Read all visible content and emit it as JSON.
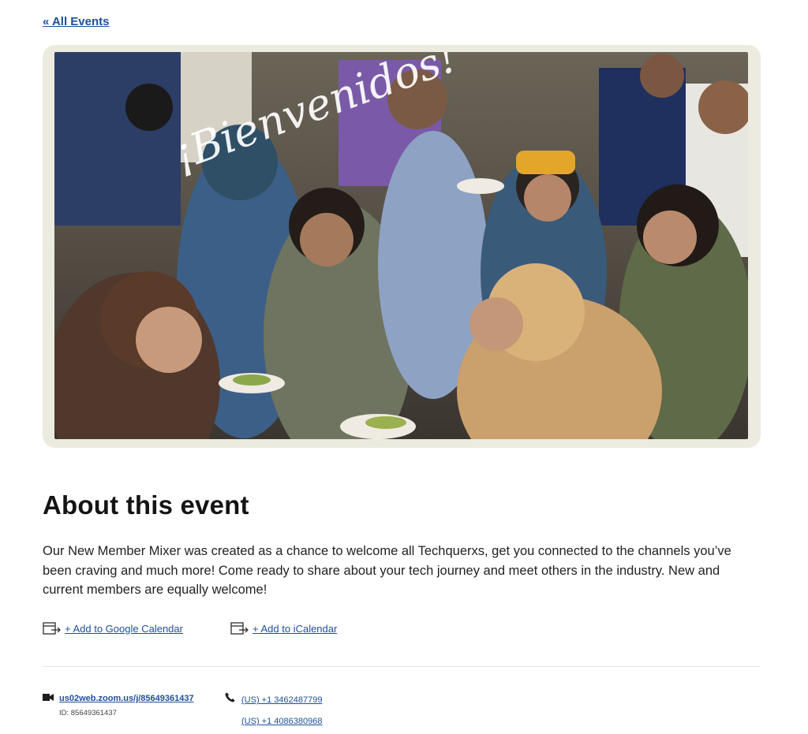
{
  "nav": {
    "back_label": "« All Events"
  },
  "hero": {
    "overlay_text": "¡Bienvenidos!"
  },
  "about": {
    "title": "About this event",
    "body": "Our New Member Mixer was created as a chance to welcome all Techquerxs, get you connected to the channels you’ve been craving and much more! Come ready to share about your tech journey and meet others in the industry. New and current members are equally welcome!"
  },
  "calendar": {
    "google_label": "+ Add to Google Calendar",
    "ical_label": "+ Add to iCalendar",
    "icon": "calendar-export-icon"
  },
  "zoom": {
    "icon": "video-camera-icon",
    "link": "us02web.zoom.us/j/85649361437",
    "meeting_id": "ID: 85649361437"
  },
  "phone": {
    "icon": "phone-icon",
    "numbers": [
      "(US) +1 3462487799",
      "(US) +1 4086380968"
    ]
  },
  "colors": {
    "link": "#1d4f9c",
    "frame": "#ecebdf",
    "heading": "#141414"
  }
}
